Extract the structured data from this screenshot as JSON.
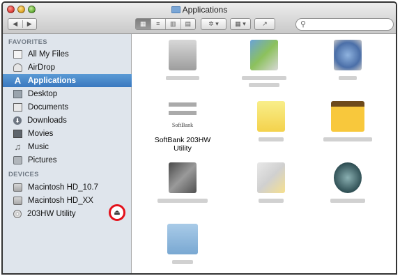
{
  "window": {
    "title": "Applications"
  },
  "toolbar": {
    "back_glyph": "◀",
    "forward_glyph": "▶",
    "view_glyphs": [
      "▦",
      "≡",
      "▥",
      "▤"
    ],
    "action_glyph": "✲ ▾",
    "arrange_glyph": "▦ ▾",
    "share_glyph": "↗",
    "search_glyph": "⚲",
    "search_placeholder": ""
  },
  "sidebar": {
    "favorites_header": "FAVORITES",
    "devices_header": "DEVICES",
    "favorites": [
      {
        "label": "All My Files",
        "icon": "all-files-icon"
      },
      {
        "label": "AirDrop",
        "icon": "airdrop-icon"
      },
      {
        "label": "Applications",
        "icon": "applications-icon",
        "selected": true
      },
      {
        "label": "Desktop",
        "icon": "desktop-icon"
      },
      {
        "label": "Documents",
        "icon": "documents-icon"
      },
      {
        "label": "Downloads",
        "icon": "downloads-icon"
      },
      {
        "label": "Movies",
        "icon": "movies-icon"
      },
      {
        "label": "Music",
        "icon": "music-icon"
      },
      {
        "label": "Pictures",
        "icon": "pictures-icon"
      }
    ],
    "devices": [
      {
        "label": "Macintosh HD_10.7",
        "icon": "hard-drive-icon"
      },
      {
        "label": "Macintosh HD_XX",
        "icon": "hard-drive-icon"
      },
      {
        "label": "203HW Utility",
        "icon": "disc-icon",
        "eject": true
      }
    ],
    "eject_glyph": "⏏",
    "selected_color": "#3a78bf"
  },
  "content": {
    "softbank_brand": "SoftBank",
    "softbank_label_line1": "SoftBank 203HW",
    "softbank_label_line2": "Utility"
  },
  "colors": {
    "highlight_circle": "#e4111b",
    "sidebar_bg": "#dfe5ec"
  }
}
